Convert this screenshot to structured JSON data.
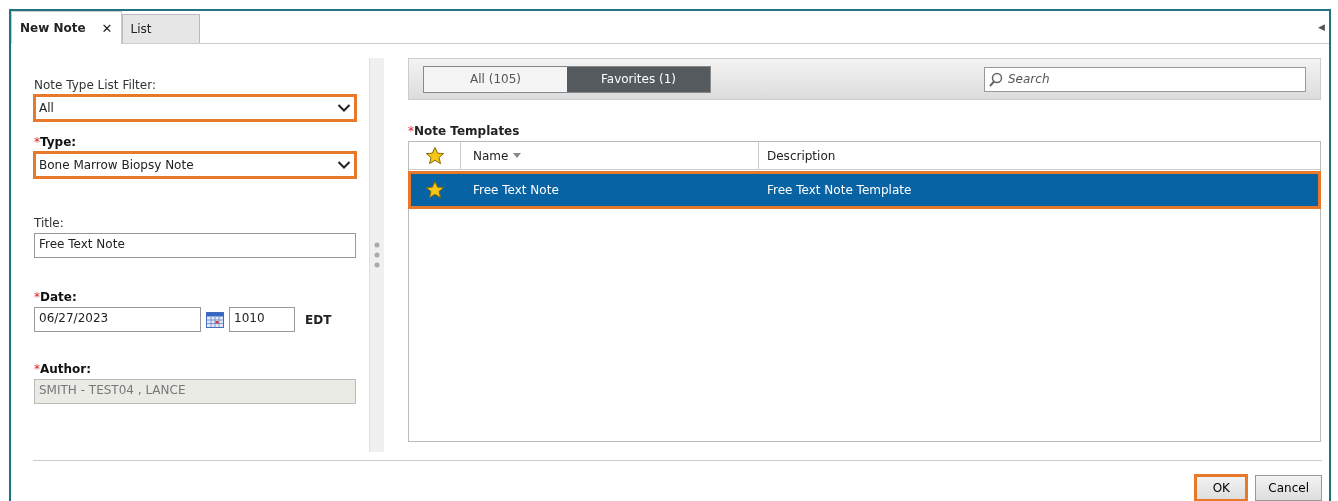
{
  "tabs": [
    {
      "label": "New Note",
      "selected": true,
      "close_glyph": "✕"
    },
    {
      "label": "List",
      "selected": false
    }
  ],
  "collapse_glyph": "◀",
  "required_mark": "*",
  "form": [
    {
      "kind": "select",
      "label": "Note Type List Filter:",
      "required": false,
      "value": "All",
      "highlighted": true
    },
    {
      "kind": "select",
      "label": "Type:",
      "required": true,
      "value": "Bone Marrow Biopsy Note",
      "highlighted": true
    },
    {
      "kind": "text",
      "label": "Title:",
      "required": false,
      "value": "Free Text Note",
      "highlighted": false
    },
    {
      "kind": "date",
      "label": "Date:",
      "required": true,
      "value": "06/27/2023",
      "time": "1010",
      "zone": "EDT",
      "highlighted": false
    },
    {
      "kind": "readonly",
      "label": "Author:",
      "required": true,
      "value": "SMITH - TEST04 , LANCE",
      "highlighted": false
    }
  ],
  "filter_tabs": [
    {
      "label": "All (105)",
      "selected": false
    },
    {
      "label": "Favorites (1)",
      "selected": true
    }
  ],
  "search": {
    "placeholder": "Search"
  },
  "templates": {
    "label": "Note Templates",
    "required": true,
    "columns": [
      "Name",
      "Description"
    ],
    "rows": [
      {
        "favorite": true,
        "name": "Free Text Note",
        "description": "Free Text Note Template",
        "selected": true,
        "highlighted": true
      }
    ]
  },
  "buttons": [
    {
      "label": "OK",
      "highlighted": true
    },
    {
      "label": "Cancel",
      "highlighted": false
    }
  ]
}
